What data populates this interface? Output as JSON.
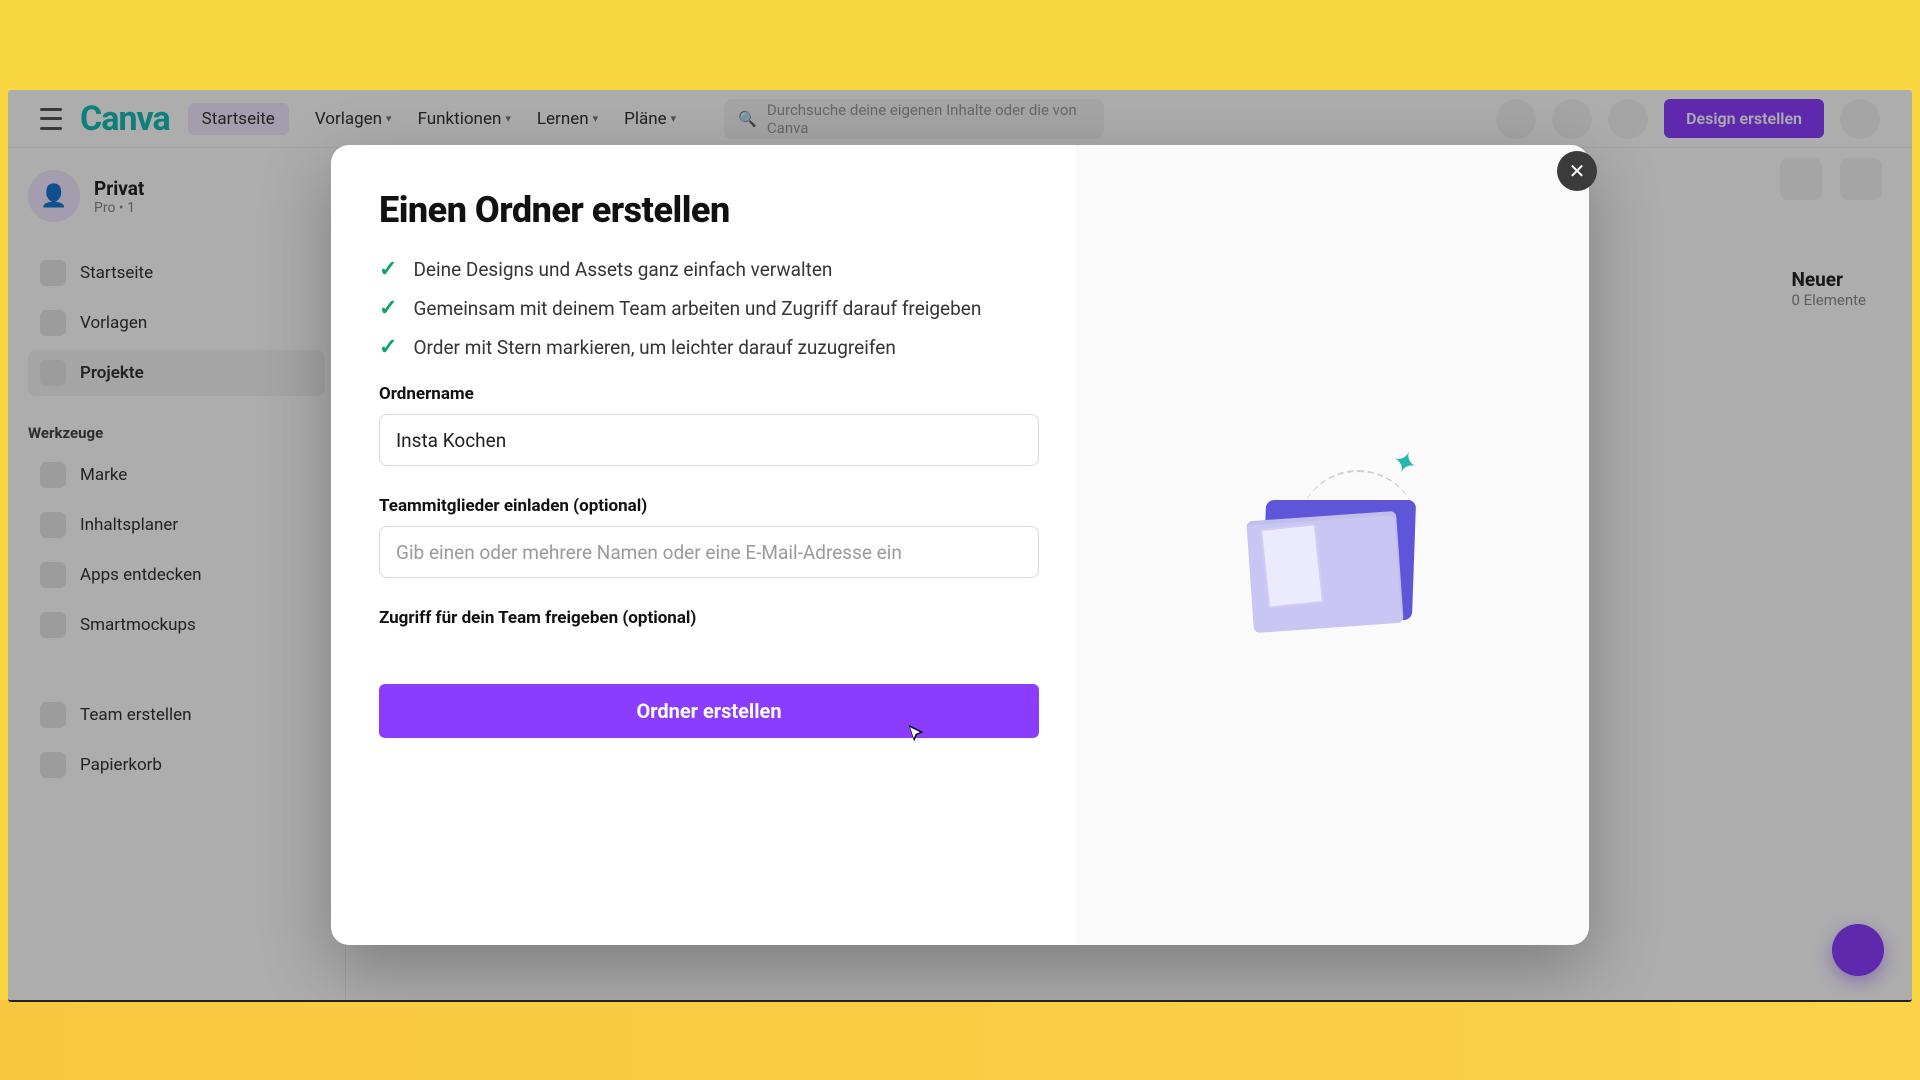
{
  "header": {
    "logo": "Canva",
    "nav": {
      "home": "Startseite",
      "templates": "Vorlagen",
      "features": "Funktionen",
      "learn": "Lernen",
      "plans": "Pläne"
    },
    "search_placeholder": "Durchsuche deine eigenen Inhalte oder die von Canva",
    "cta": "Design erstellen"
  },
  "sidebar": {
    "user": {
      "name": "Privat",
      "sub": "Pro • 1"
    },
    "items": [
      {
        "label": "Startseite"
      },
      {
        "label": "Vorlagen"
      },
      {
        "label": "Projekte",
        "active": true
      }
    ],
    "tools_heading": "Werkzeuge",
    "tools": [
      {
        "label": "Marke"
      },
      {
        "label": "Inhaltsplaner"
      },
      {
        "label": "Apps entdecken"
      },
      {
        "label": "Smartmockups"
      }
    ],
    "bottom": [
      {
        "label": "Team erstellen"
      },
      {
        "label": "Papierkorb"
      }
    ]
  },
  "main": {
    "folder_name": "Neuer",
    "folder_sub": "0 Elemente"
  },
  "modal": {
    "title": "Einen Ordner erstellen",
    "benefits": [
      "Deine Designs und Assets ganz einfach verwalten",
      "Gemeinsam mit deinem Team arbeiten und Zugriff darauf freigeben",
      "Order mit Stern markieren, um leichter darauf zuzugreifen"
    ],
    "folder_label": "Ordnername",
    "folder_value": "Insta Kochen",
    "invite_label": "Teammitglieder einladen (optional)",
    "invite_placeholder": "Gib einen oder mehrere Namen oder eine E-Mail-Adresse ein",
    "share_label": "Zugriff für dein Team freigeben (optional)",
    "submit": "Ordner erstellen"
  },
  "colors": {
    "accent": "#8b3dff",
    "check": "#0aa567"
  }
}
